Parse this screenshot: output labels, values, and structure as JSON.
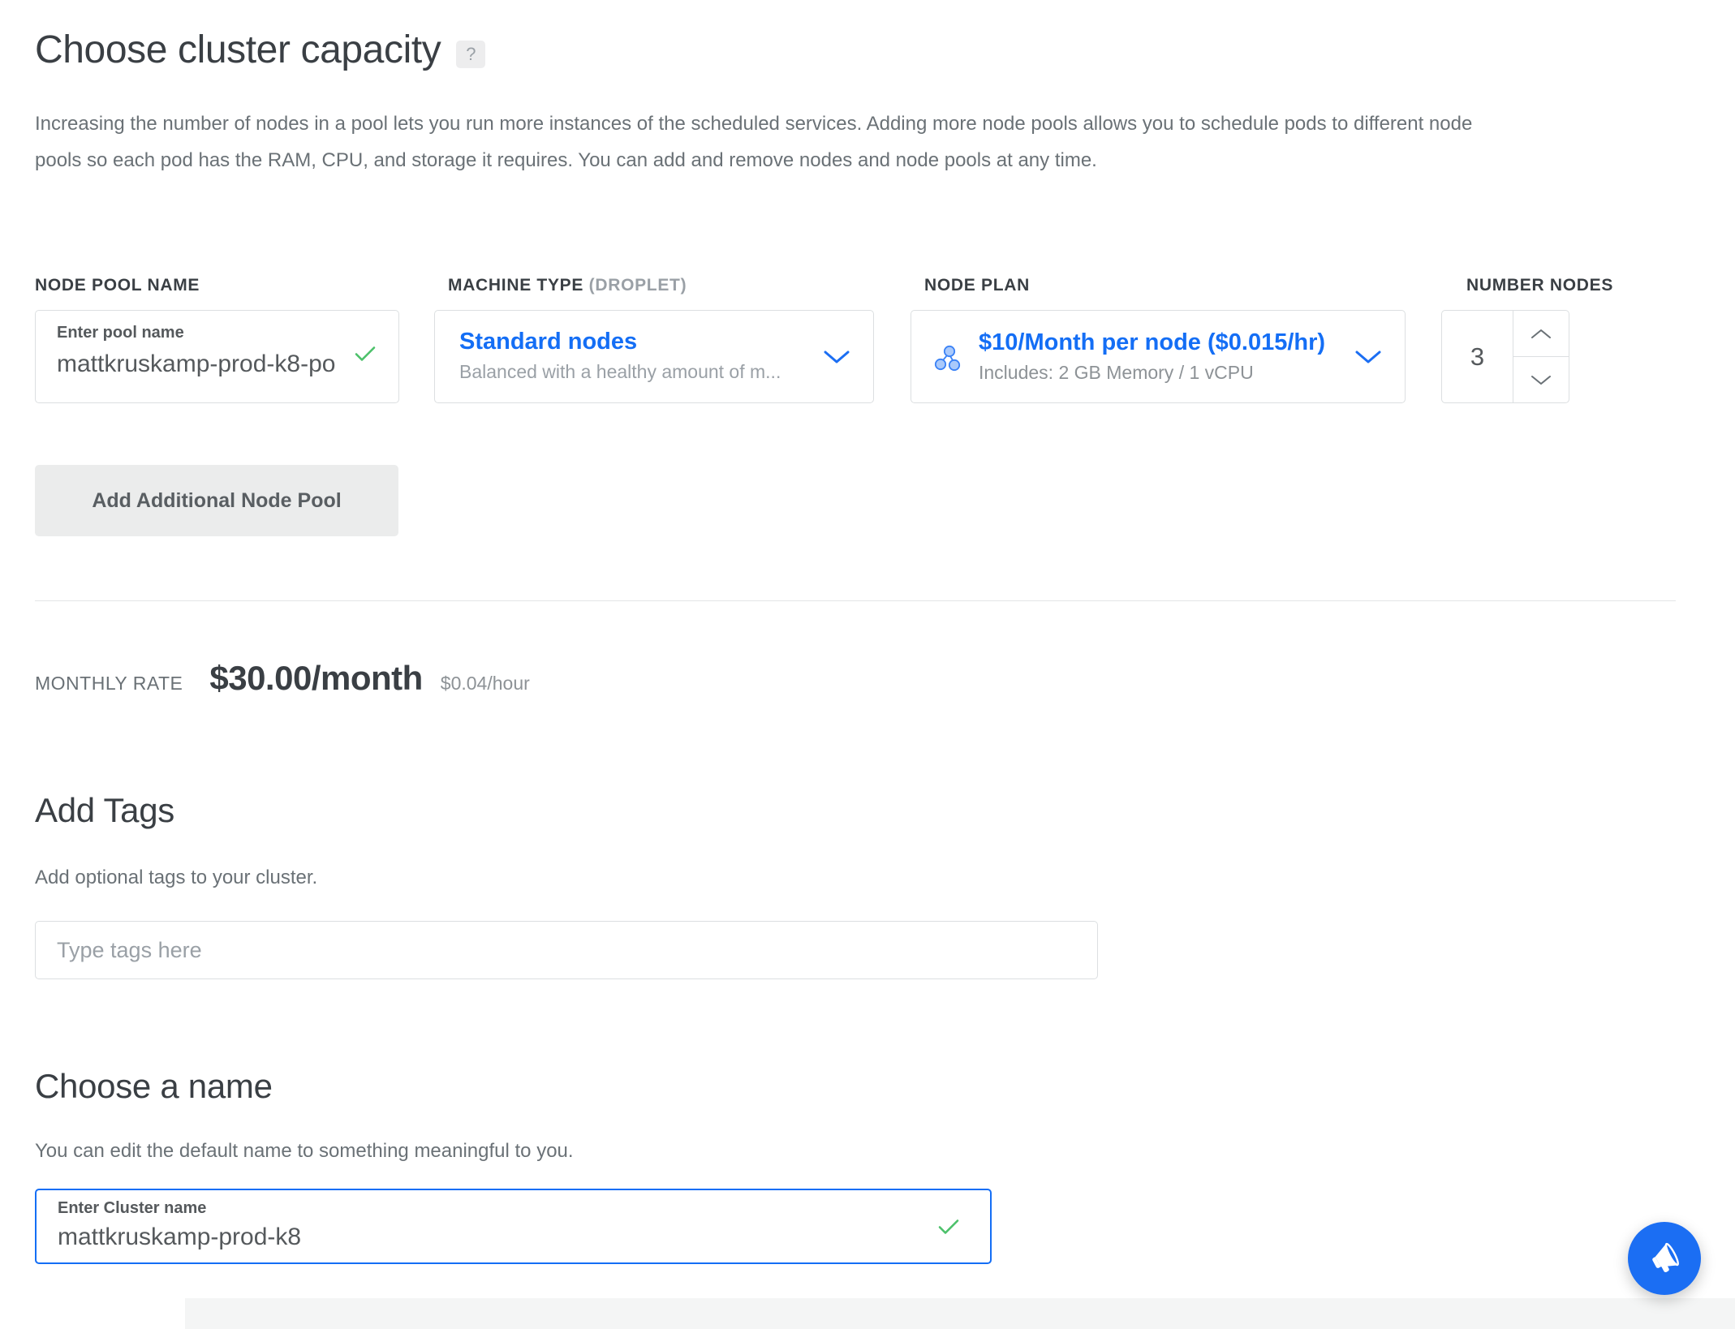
{
  "section": {
    "title": "Choose cluster capacity",
    "help_badge": "?",
    "description": "Increasing the number of nodes in a pool lets you run more instances of the scheduled services. Adding more node pools allows you to schedule pods to different node pools so each pod has the RAM, CPU, and storage it requires. You can add and remove nodes and node pools at any time."
  },
  "form": {
    "node_pool_name": {
      "label": "NODE POOL NAME",
      "float_label": "Enter pool name",
      "value": "mattkruskamp-prod-k8-po",
      "valid_icon": "check-icon"
    },
    "machine_type": {
      "label_strong": "MACHINE TYPE",
      "label_muted": "(DROPLET)",
      "selected_title": "Standard nodes",
      "selected_subtitle": "Balanced with a healthy amount of m...",
      "chevron_icon": "chevron-down-icon"
    },
    "node_plan": {
      "label": "NODE PLAN",
      "icon": "node-cluster-icon",
      "selected_title": "$10/Month per node ($0.015/hr)",
      "selected_subtitle": "Includes: 2 GB Memory / 1 vCPU",
      "chevron_icon": "chevron-down-icon"
    },
    "number_nodes": {
      "label": "NUMBER NODES",
      "value": "3",
      "increment_icon": "chevron-up-icon",
      "decrement_icon": "chevron-down-icon"
    },
    "add_pool_button": "Add Additional Node Pool"
  },
  "rate": {
    "label": "MONTHLY RATE",
    "monthly": "$30.00/month",
    "hourly": "$0.04/hour"
  },
  "tags": {
    "title": "Add Tags",
    "subtitle": "Add optional tags to your cluster.",
    "placeholder": "Type tags here",
    "value": ""
  },
  "cluster_name": {
    "title": "Choose a name",
    "subtitle": "You can edit the default name to something meaningful to you.",
    "float_label": "Enter Cluster name",
    "value": "mattkruskamp-prod-k8",
    "valid_icon": "check-icon"
  },
  "fab": {
    "icon": "megaphone-icon"
  },
  "colors": {
    "accent_blue": "#146ef5",
    "fab_blue": "#1b6ef3",
    "valid_green": "#4cc16a",
    "text_dark": "#3a3f44",
    "text_muted": "#6a7176",
    "border": "#dcdfe1",
    "button_bg": "#ebecec"
  }
}
